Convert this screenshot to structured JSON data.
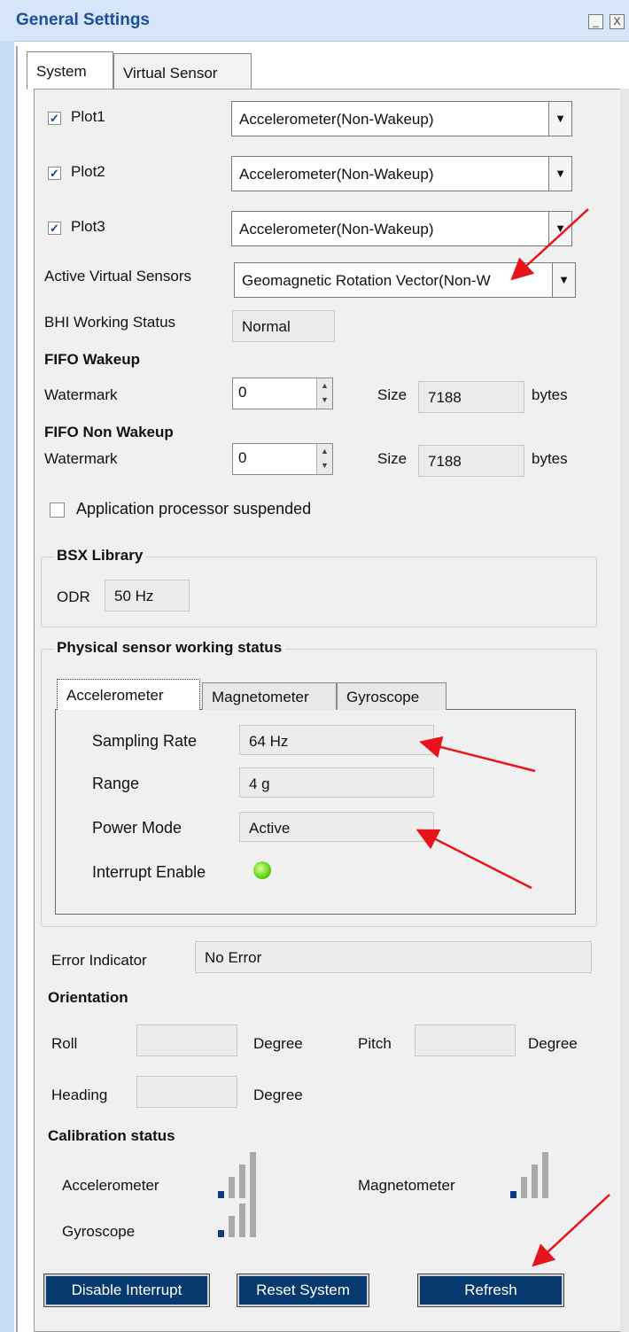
{
  "window": {
    "title": "General Settings",
    "minimize_glyph": "_",
    "close_glyph": "X"
  },
  "tabs": [
    {
      "label": "System",
      "active": true
    },
    {
      "label": "Virtual Sensor",
      "active": false
    }
  ],
  "plots": [
    {
      "label": "Plot1",
      "checked": true,
      "value": "Accelerometer(Non-Wakeup)"
    },
    {
      "label": "Plot2",
      "checked": true,
      "value": "Accelerometer(Non-Wakeup)"
    },
    {
      "label": "Plot3",
      "checked": true,
      "value": "Accelerometer(Non-Wakeup)"
    }
  ],
  "active_virtual_sensors": {
    "label": "Active Virtual Sensors",
    "value": "Geomagnetic Rotation Vector(Non-W"
  },
  "bhi_status": {
    "label": "BHI Working Status",
    "value": "Normal"
  },
  "fifo_wakeup": {
    "heading": "FIFO Wakeup",
    "watermark_label": "Watermark",
    "watermark_value": "0",
    "size_label": "Size",
    "size_value": "7188",
    "unit": "bytes"
  },
  "fifo_non_wakeup": {
    "heading": "FIFO Non Wakeup",
    "watermark_label": "Watermark",
    "watermark_value": "0",
    "size_label": "Size",
    "size_value": "7188",
    "unit": "bytes"
  },
  "app_processor": {
    "label": "Application processor suspended",
    "checked": false
  },
  "bsx": {
    "heading": "BSX Library",
    "odr_label": "ODR",
    "odr_value": "50 Hz"
  },
  "physical": {
    "heading": "Physical sensor working status",
    "tabs": [
      "Accelerometer",
      "Magnetometer",
      "Gyroscope"
    ],
    "sampling_rate_label": "Sampling Rate",
    "sampling_rate_value": "64 Hz",
    "range_label": "Range",
    "range_value": "4 g",
    "power_mode_label": "Power Mode",
    "power_mode_value": "Active",
    "interrupt_label": "Interrupt Enable",
    "interrupt_color": "#5fd21a"
  },
  "error": {
    "label": "Error Indicator",
    "value": "No Error"
  },
  "orientation": {
    "heading": "Orientation",
    "roll_label": "Roll",
    "pitch_label": "Pitch",
    "heading_label": "Heading",
    "unit": "Degree"
  },
  "calibration": {
    "heading": "Calibration status",
    "items": [
      {
        "label": "Accelerometer",
        "level": 1
      },
      {
        "label": "Magnetometer",
        "level": 1
      },
      {
        "label": "Gyroscope",
        "level": 1
      }
    ],
    "active_color": "#0b3a8a",
    "inactive_color": "#a9a9a9"
  },
  "buttons": {
    "disable_interrupt": "Disable Interrupt",
    "reset_system": "Reset System",
    "refresh": "Refresh"
  },
  "colors": {
    "button_bg": "#063a6e",
    "title_text": "#1f4d9a",
    "annotation_arrow": "#e8141b"
  }
}
